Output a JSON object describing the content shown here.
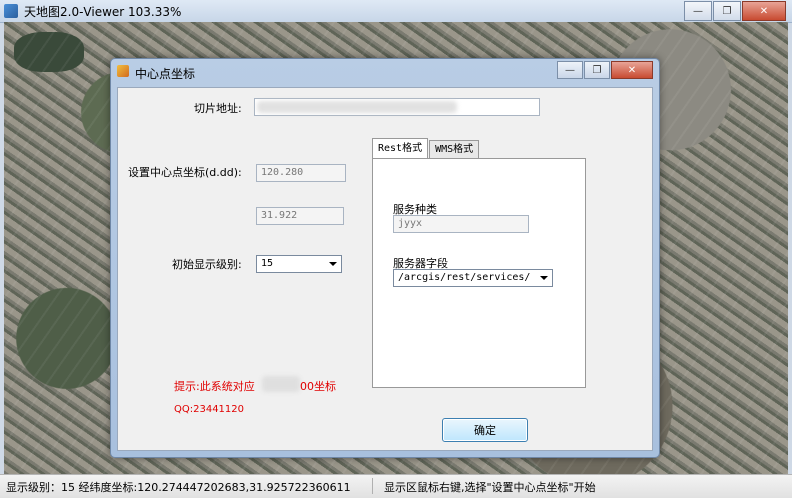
{
  "window": {
    "title": "天地图2.0-Viewer  103.33%",
    "minimize": "—",
    "maximize": "❐",
    "close": "✕"
  },
  "dialog": {
    "title": "中心点坐标",
    "minimize": "—",
    "maximize": "❐",
    "close": "✕",
    "tile_url_label": "切片地址:",
    "center_label": "设置中心点坐标(d.dd):",
    "center_x": "120.280",
    "center_y": "31.922",
    "init_level_label": "初始显示级别:",
    "init_level_value": "15",
    "tabs": [
      {
        "label": "Rest格式",
        "active": true
      },
      {
        "label": "WMS格式",
        "active": false
      }
    ],
    "service_type_label": "服务种类",
    "service_type_value": "jyyx",
    "service_field_label": "服务器字段",
    "service_field_value": "/arcgis/rest/services/",
    "hint_text_a": "提示:此系统对应",
    "hint_text_b": "00坐标",
    "qq_text": "QQ:23441120",
    "ok_label": "确定"
  },
  "statusbar": {
    "left": "显示级别：15  经纬度坐标:120.274447202683,31.925722360611",
    "right": "显示区鼠标右键,选择\"设置中心点坐标\"开始"
  },
  "colors": {
    "hint": "#e00000",
    "accent": "#3c7fb1"
  }
}
